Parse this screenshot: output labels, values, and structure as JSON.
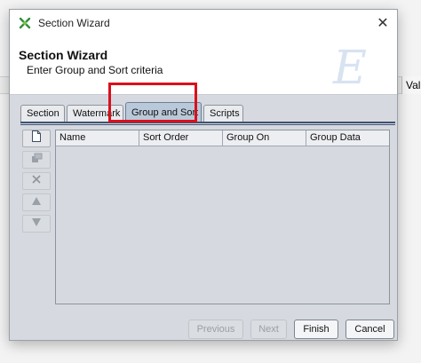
{
  "background": {
    "column_label": "Val"
  },
  "window": {
    "title": "Section Wizard",
    "close_label": "✕"
  },
  "wizard": {
    "title": "Section Wizard",
    "subtitle": "Enter Group and Sort criteria",
    "watermark_letter": "E"
  },
  "tabs": [
    {
      "label": "Section",
      "active": false
    },
    {
      "label": "Watermark",
      "active": false
    },
    {
      "label": "Group and Sort",
      "active": true
    },
    {
      "label": "Scripts",
      "active": false
    }
  ],
  "side_toolbar": [
    {
      "name": "new-icon",
      "enabled": true
    },
    {
      "name": "properties-icon",
      "enabled": false
    },
    {
      "name": "delete-icon",
      "enabled": false
    },
    {
      "name": "move-up-icon",
      "enabled": false
    },
    {
      "name": "move-down-icon",
      "enabled": false
    }
  ],
  "table": {
    "columns": [
      "Name",
      "Sort Order",
      "Group On",
      "Group Data"
    ],
    "rows": []
  },
  "footer": {
    "previous_label": "Previous",
    "next_label": "Next",
    "finish_label": "Finish",
    "cancel_label": "Cancel"
  },
  "colors": {
    "highlight": "#d9101c",
    "active_tab": "#b9c9da",
    "tab_rule": "#3e5372"
  }
}
